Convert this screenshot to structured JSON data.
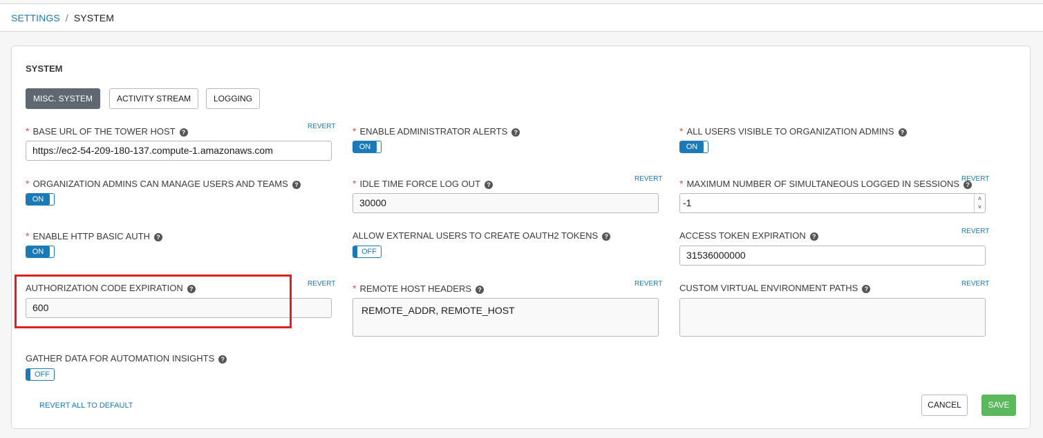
{
  "breadcrumb": {
    "settings": "SETTINGS",
    "separator": "/",
    "current": "SYSTEM"
  },
  "panel": {
    "title": "SYSTEM"
  },
  "tabs": [
    {
      "label": "MISC. SYSTEM",
      "active": true
    },
    {
      "label": "ACTIVITY STREAM",
      "active": false
    },
    {
      "label": "LOGGING",
      "active": false
    }
  ],
  "revert_label": "REVERT",
  "help_glyph": "?",
  "required_mark": "*",
  "fields": {
    "base_url": {
      "label": "BASE URL OF THE TOWER HOST",
      "value": "https://ec2-54-209-180-137.compute-1.amazonaws.com"
    },
    "admin_alerts": {
      "label": "ENABLE ADMINISTRATOR ALERTS",
      "state": "ON"
    },
    "users_visible": {
      "label": "ALL USERS VISIBLE TO ORGANIZATION ADMINS",
      "state": "ON"
    },
    "org_admins_manage": {
      "label": "ORGANIZATION ADMINS CAN MANAGE USERS AND TEAMS",
      "state": "ON"
    },
    "idle_logout": {
      "label": "IDLE TIME FORCE LOG OUT",
      "value": "30000"
    },
    "max_sessions": {
      "label": "MAXIMUM NUMBER OF SIMULTANEOUS LOGGED IN SESSIONS",
      "value": "-1"
    },
    "http_basic_auth": {
      "label": "ENABLE HTTP BASIC AUTH",
      "state": "ON"
    },
    "external_oauth": {
      "label": "ALLOW EXTERNAL USERS TO CREATE OAUTH2 TOKENS",
      "state": "OFF"
    },
    "access_token_exp": {
      "label": "ACCESS TOKEN EXPIRATION",
      "value": "31536000000"
    },
    "auth_code_exp": {
      "label": "AUTHORIZATION CODE EXPIRATION",
      "value": "600"
    },
    "remote_host_headers": {
      "label": "REMOTE HOST HEADERS",
      "value": "REMOTE_ADDR, REMOTE_HOST"
    },
    "custom_venv_paths": {
      "label": "CUSTOM VIRTUAL ENVIRONMENT PATHS",
      "value": ""
    },
    "automation_insights": {
      "label": "GATHER DATA FOR AUTOMATION INSIGHTS",
      "state": "OFF"
    }
  },
  "footer": {
    "revert_all": "REVERT ALL TO DEFAULT",
    "cancel": "CANCEL",
    "save": "SAVE"
  },
  "spinner": {
    "up": "˄",
    "down": "˅"
  },
  "colors": {
    "accent": "#1a7ab7",
    "required": "#d9534f",
    "save": "#5cb85c",
    "highlight": "#e11d1d",
    "active_tab": "#5f6770"
  }
}
